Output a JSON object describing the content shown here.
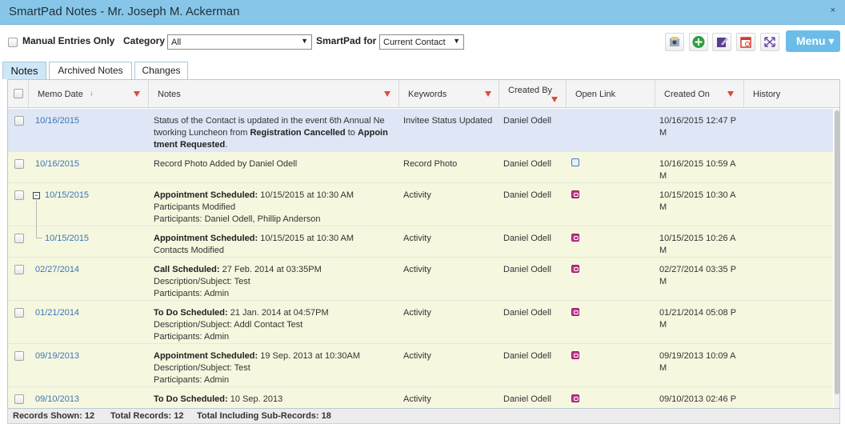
{
  "window": {
    "title": "SmartPad Notes - Mr. Joseph M. Ackerman",
    "close_glyph": "×"
  },
  "toolbar": {
    "manual_entries_label": "Manual Entries Only",
    "category_label": "Category",
    "category_value": "All",
    "smartpad_for_label": "SmartPad for",
    "smartpad_for_value": "Current Contact",
    "menu_label": "Menu ▾",
    "icons": [
      "contact-card-icon",
      "add-icon",
      "compose-note-icon",
      "calendar-icon",
      "expand-icon"
    ]
  },
  "tabs": [
    {
      "label": "Notes",
      "active": true
    },
    {
      "label": "Archived Notes",
      "active": false
    },
    {
      "label": "Changes",
      "active": false
    }
  ],
  "columns": {
    "memo_date": "Memo Date",
    "notes": "Notes",
    "keywords": "Keywords",
    "created_by": "Created By",
    "open_link": "Open Link",
    "created_on": "Created On",
    "history": "History"
  },
  "rows": [
    {
      "date": "10/16/2015",
      "notes_lines": [
        "Status of the Contact is updated in the event 6th Annual Ne",
        "tworking Luncheon from ",
        "Registration Cancelled",
        " to ",
        "Appoin",
        "tment Requested",
        "."
      ],
      "keyword": "Invitee Status Updated",
      "created_by": "Daniel Odell",
      "created_on_1": "10/16/2015 12:47 P",
      "created_on_2": "M"
    },
    {
      "date": "10/16/2015",
      "notes_1": "Record Photo Added by Daniel Odell",
      "keyword": "Record Photo",
      "created_by": "Daniel Odell",
      "created_on_1": "10/16/2015 10:59 A",
      "created_on_2": "M"
    },
    {
      "date": "10/15/2015",
      "notes_title": "Appointment Scheduled:",
      "notes_title_rest": " 10/15/2015 at 10:30 AM",
      "notes_2": "Participants Modified",
      "notes_3": "Participants: Daniel Odell, Phillip Anderson",
      "keyword": "Activity",
      "created_by": "Daniel Odell",
      "created_on_1": "10/15/2015 10:30 A",
      "created_on_2": "M"
    },
    {
      "date": "10/15/2015",
      "notes_title": "Appointment Scheduled:",
      "notes_title_rest": " 10/15/2015 at 10:30 AM",
      "notes_2": "Contacts Modified",
      "keyword": "Activity",
      "created_by": "Daniel Odell",
      "created_on_1": "10/15/2015 10:26 A",
      "created_on_2": "M"
    },
    {
      "date": "02/27/2014",
      "notes_title": "Call Scheduled:",
      "notes_title_rest": " 27 Feb. 2014 at 03:35PM",
      "notes_2": "Description/Subject: Test",
      "notes_3": "Participants: Admin",
      "keyword": "Activity",
      "created_by": "Daniel Odell",
      "created_on_1": "02/27/2014 03:35 P",
      "created_on_2": "M"
    },
    {
      "date": "01/21/2014",
      "notes_title": "To Do Scheduled:",
      "notes_title_rest": " 21 Jan. 2014 at 04:57PM",
      "notes_2": "Description/Subject: Addl Contact Test",
      "notes_3": "Participants: Admin",
      "keyword": "Activity",
      "created_by": "Daniel Odell",
      "created_on_1": "01/21/2014 05:08 P",
      "created_on_2": "M"
    },
    {
      "date": "09/19/2013",
      "notes_title": "Appointment Scheduled:",
      "notes_title_rest": " 19 Sep. 2013 at 10:30AM",
      "notes_2": "Description/Subject: Test",
      "notes_3": "Participants: Admin",
      "keyword": "Activity",
      "created_by": "Daniel Odell",
      "created_on_1": "09/19/2013 10:09 A",
      "created_on_2": "M"
    },
    {
      "date": "09/10/2013",
      "notes_title": "To Do Scheduled:",
      "notes_title_rest": " 10 Sep. 2013",
      "keyword": "Activity",
      "created_by": "Daniel Odell",
      "created_on_1": "09/10/2013 02:46 P",
      "created_on_2": ""
    }
  ],
  "footer": {
    "records_shown": "Records Shown: 12",
    "total_records": "Total Records: 12",
    "total_including": "Total Including Sub-Records: 18"
  },
  "colors": {
    "titlebar": "#87c6e8",
    "selected_row": "#dfe6f5",
    "row": "#f6f7df",
    "link": "#3a76b5",
    "filter": "#e14a3b",
    "menu": "#6bbde8"
  }
}
